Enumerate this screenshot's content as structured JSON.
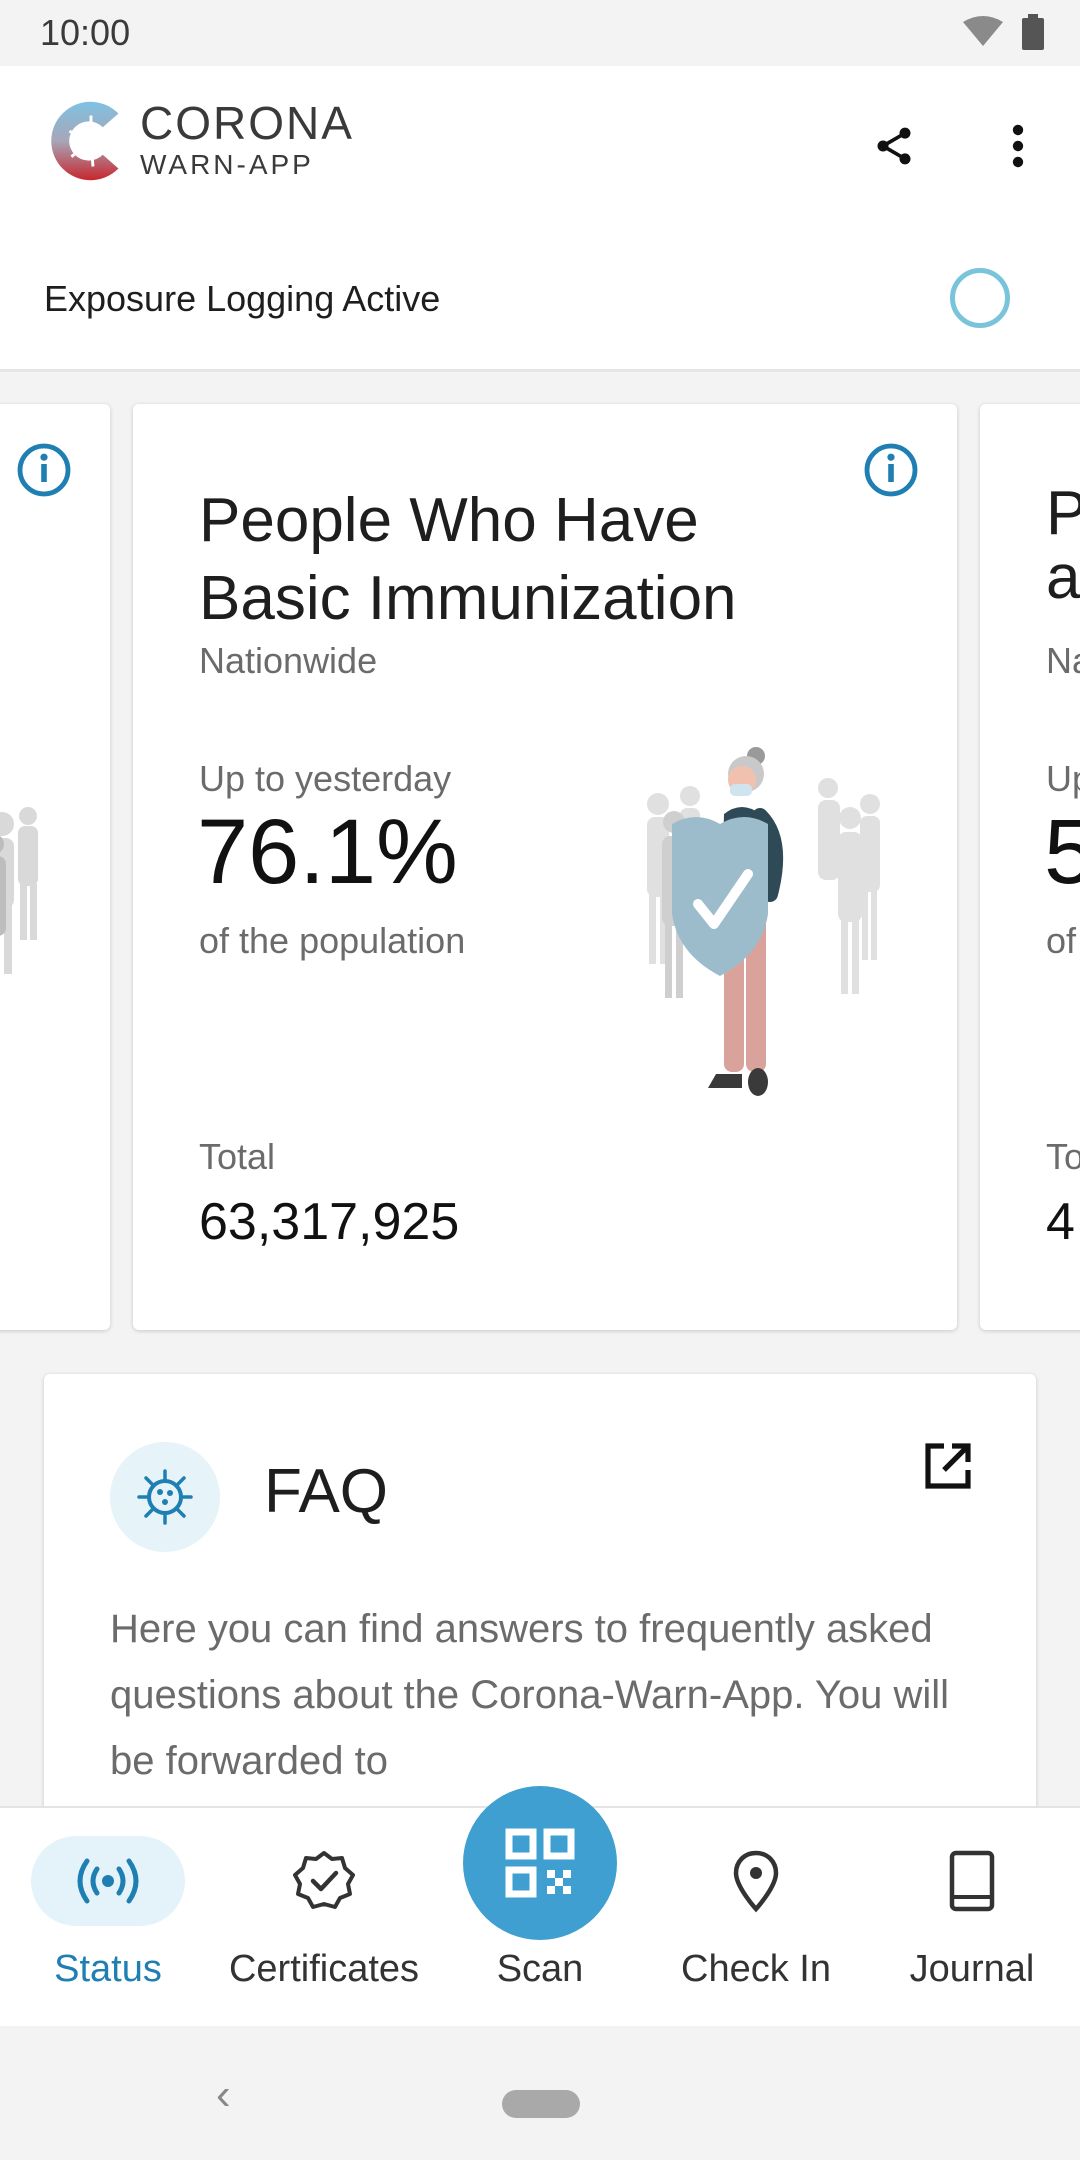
{
  "status_bar": {
    "time": "10:00"
  },
  "header": {
    "logo_line1": "CORONA",
    "logo_line2": "WARN-APP",
    "share_icon": "share-icon",
    "menu_icon": "more-vert-icon"
  },
  "exposure": {
    "label": "Exposure Logging Active"
  },
  "stat_card": {
    "title": "People Who Have Basic Immunization",
    "region": "Nationwide",
    "up_to": "Up to yesterday",
    "value": "76.1%",
    "of_population": "of the population",
    "total_label": "Total",
    "total_value": "63,317,925"
  },
  "next_card_peek": {
    "title_line1": "P",
    "title_line2": "a",
    "region": "Na",
    "up_to": "Up",
    "value": "5",
    "of": "of",
    "total_label": "To",
    "total_value": "4"
  },
  "faq": {
    "title": "FAQ",
    "text": "Here you can find answers to frequently asked questions about the Corona-Warn-App. You will be forwarded to"
  },
  "bottom_nav": {
    "items": [
      {
        "label": "Status",
        "icon": "broadcast-icon",
        "active": true
      },
      {
        "label": "Certificates",
        "icon": "certificate-badge-icon",
        "active": false
      },
      {
        "label": "Scan",
        "icon": "qr-code-icon",
        "active": false
      },
      {
        "label": "Check In",
        "icon": "location-pin-icon",
        "active": false
      },
      {
        "label": "Journal",
        "icon": "book-icon",
        "active": false
      }
    ]
  },
  "colors": {
    "accent": "#1f7fb2",
    "fab": "#3e9fd0",
    "ring": "#7ac4db",
    "active_pill": "#e4f3fa"
  }
}
